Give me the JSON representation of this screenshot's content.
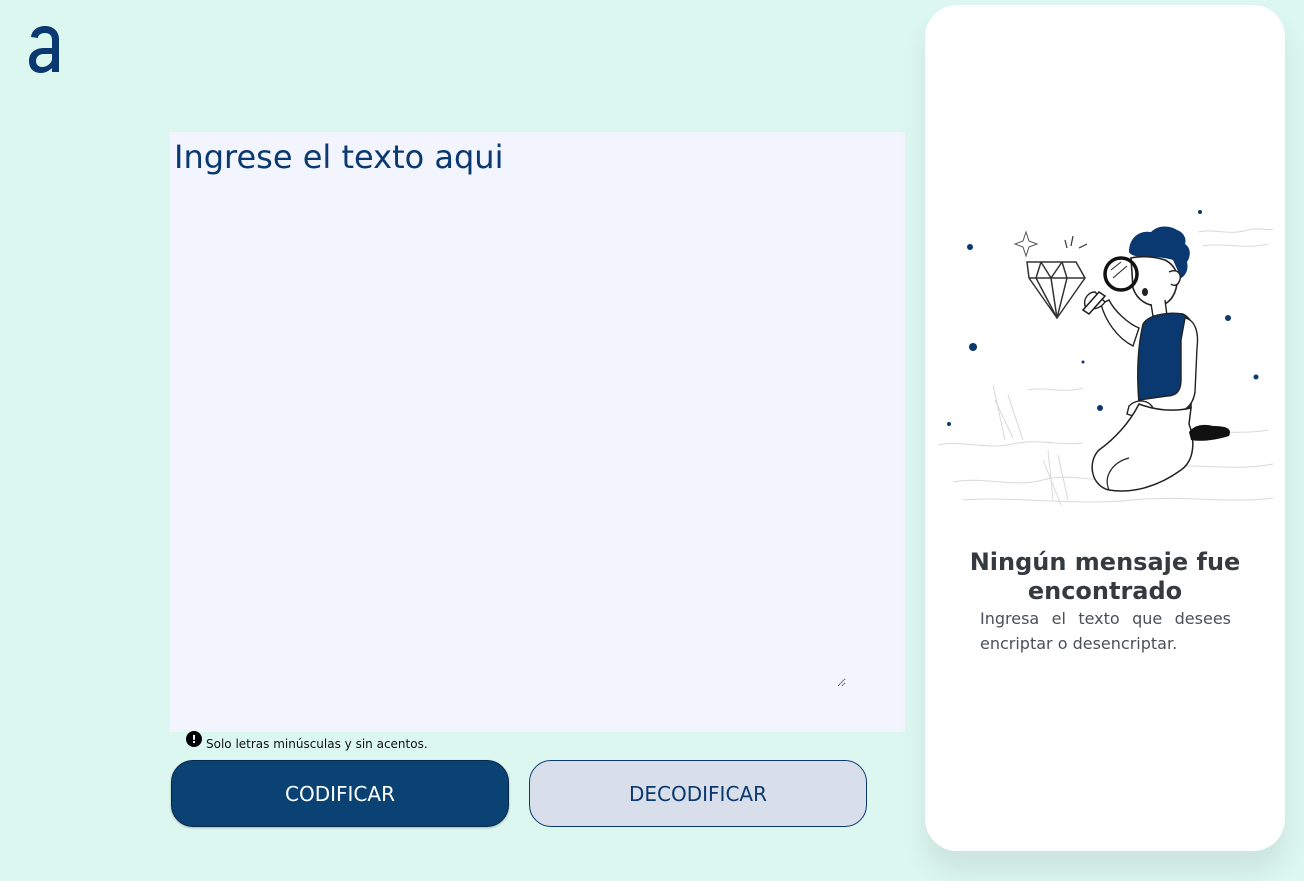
{
  "logo": {
    "icon": "alura-logo-icon",
    "color": "#0a3871"
  },
  "input": {
    "placeholder": "Ingrese el texto aqui",
    "value": ""
  },
  "hint": {
    "icon": "alert-circle-icon",
    "text": "Solo letras minúsculas y sin acentos."
  },
  "buttons": {
    "encode_label": "CODIFICAR",
    "decode_label": "DECODIFICAR"
  },
  "output": {
    "illustration": "person-with-magnifying-glass-illustration",
    "title": "Ningún mensaje fue encontrado",
    "description": "Ingresa el texto que desees encriptar o desencriptar."
  },
  "colors": {
    "background": "#dcf7f0",
    "input_background": "#f2f5fd",
    "accent": "#0a3871",
    "primary_button": "#0a4273",
    "secondary_button": "#d8dfea",
    "card": "#ffffff"
  }
}
